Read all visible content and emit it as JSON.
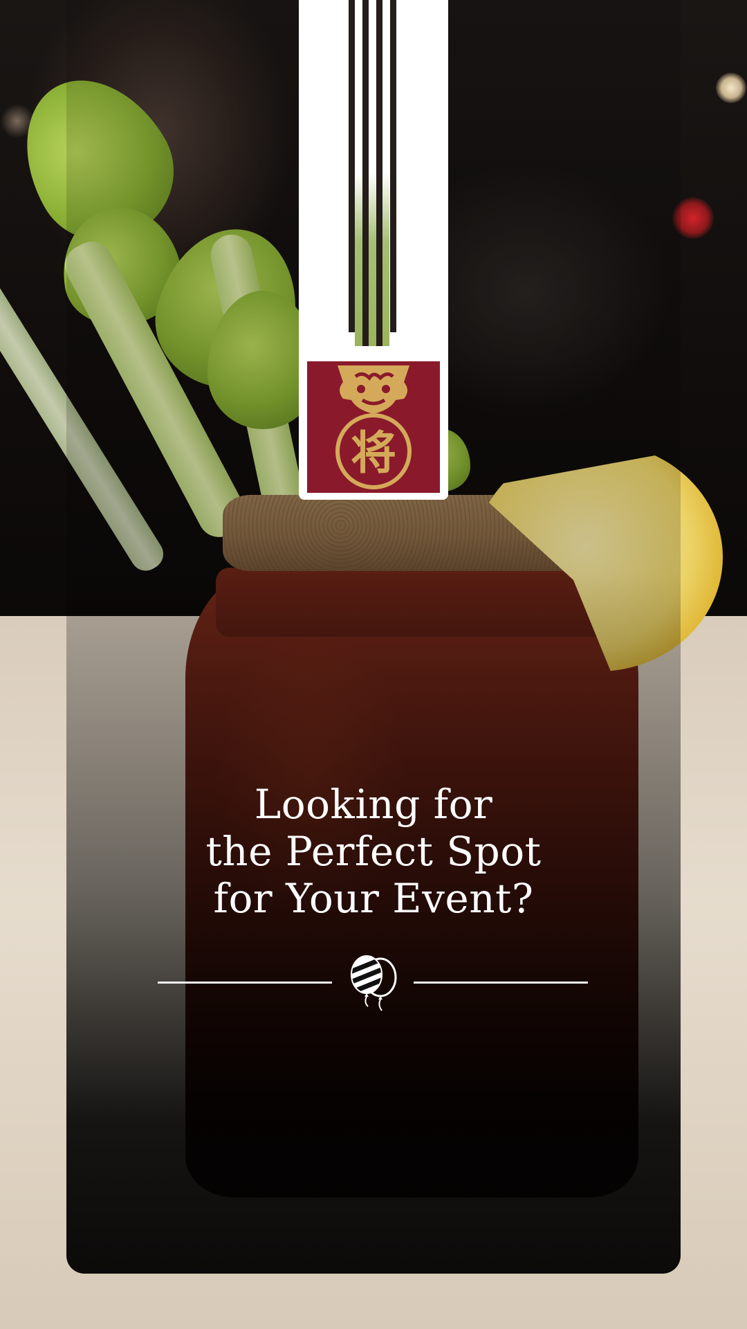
{
  "headline": {
    "line1": "Looking for",
    "line2": "the Perfect Spot",
    "line3": "for Your Event?"
  },
  "logo": {
    "glyph": "将",
    "strip_color": "#ffffff",
    "emblem_color": "#8a1a2b",
    "emblem_gold": "#d4aa5a"
  },
  "divider": {
    "icon": "balloons-icon"
  }
}
